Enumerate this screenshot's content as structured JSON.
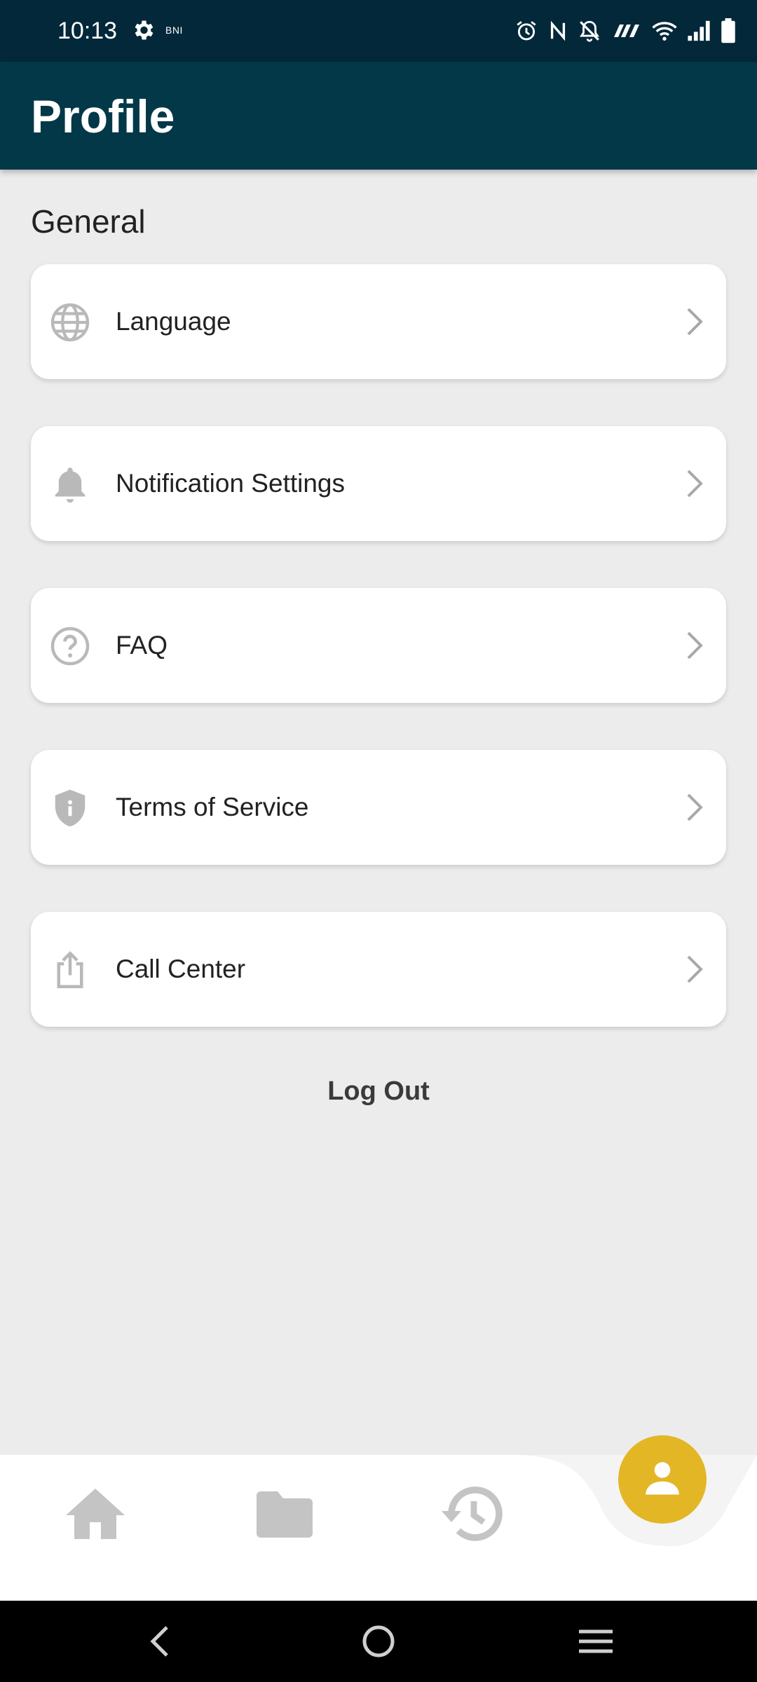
{
  "status_bar": {
    "time": "10:13",
    "brand_text": "BNI",
    "icons": [
      "settings-gear-icon",
      "alarm-icon",
      "nfc-icon",
      "notifications-off-icon",
      "volte-icon",
      "wifi-icon",
      "signal-icon",
      "battery-icon"
    ]
  },
  "header": {
    "title": "Profile"
  },
  "section": {
    "title": "General"
  },
  "menu": {
    "items": [
      {
        "label": "Language",
        "icon": "globe-icon"
      },
      {
        "label": "Notification Settings",
        "icon": "bell-icon"
      },
      {
        "label": "FAQ",
        "icon": "help-circle-icon"
      },
      {
        "label": "Terms of Service",
        "icon": "shield-icon"
      },
      {
        "label": "Call Center",
        "icon": "share-icon"
      }
    ]
  },
  "logout": {
    "label": "Log Out"
  },
  "bottom_nav": {
    "items": [
      "home-icon",
      "folder-icon",
      "history-icon",
      "profile-icon"
    ],
    "active": "profile-icon"
  },
  "colors": {
    "status_bar": "#02283a",
    "app_bar": "#023848",
    "background": "#ececec",
    "accent": "#e3b626",
    "icon_gray": "#b9b9b9"
  }
}
